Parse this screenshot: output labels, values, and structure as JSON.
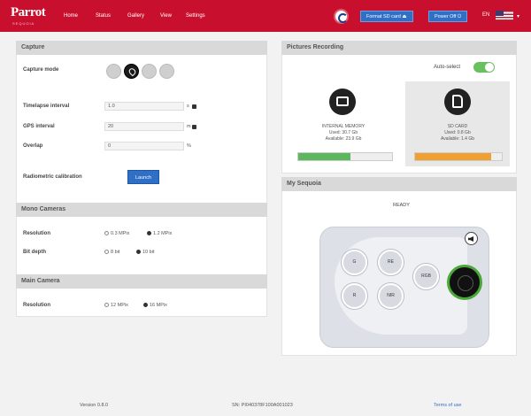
{
  "header": {
    "brand": "Parrot",
    "brand_sub": "SEQUOIA",
    "nav": [
      "Home",
      "Status",
      "Gallery",
      "View",
      "Settings"
    ],
    "format_sd_label": "Format SD card",
    "power_off_label": "Power Off",
    "language": "EN"
  },
  "capture": {
    "title": "Capture",
    "mode_label": "Capture mode",
    "timelapse_label": "Timelapse interval",
    "timelapse_value": "1.0",
    "gps_label": "GPS interval",
    "gps_value": "20",
    "overlap_label": "Overlap",
    "overlap_value": "0",
    "unit_s": "s",
    "unit_m": "m",
    "unit_pct": "%",
    "radiometric_label": "Radiometric calibration",
    "launch_label": "Launch"
  },
  "mono_camera": {
    "title": "Mono Cameras",
    "resolution_label": "Resolution",
    "resolution_options": [
      "0.3 MPix",
      "1.2 MPix"
    ],
    "bitdepth_label": "Bit depth",
    "bitdepth_options": [
      "8 bit",
      "10 bit"
    ]
  },
  "rgb_camera": {
    "title": "Main Camera",
    "resolution_label": "Resolution",
    "resolution_options": [
      "12 MPix",
      "16 MPix"
    ]
  },
  "storage": {
    "title": "Pictures Recording",
    "autoselect_label": "Auto-select",
    "internal": {
      "name": "INTERNAL MEMORY",
      "used": "Used: 30.7 Gb",
      "available": "Available: 23.9 Gb",
      "percent": 56
    },
    "sd": {
      "name": "SD CARD",
      "used": "Used: 0.8 Gb",
      "available": "Available: 1.4 Gb",
      "percent": 88
    }
  },
  "sequoia": {
    "title": "My Sequoia",
    "status": "READY",
    "keys": [
      "G",
      "RE",
      "R",
      "NIR",
      "RGB"
    ]
  },
  "footer": {
    "version": "Version 0.8.0",
    "serial": "SN: PI040378F100A001023",
    "terms": "Terms of use"
  },
  "colors": {
    "brand_red": "#c8102e",
    "accent_blue": "#2f6fc6",
    "green": "#5cb85c",
    "orange": "#f0a030"
  }
}
